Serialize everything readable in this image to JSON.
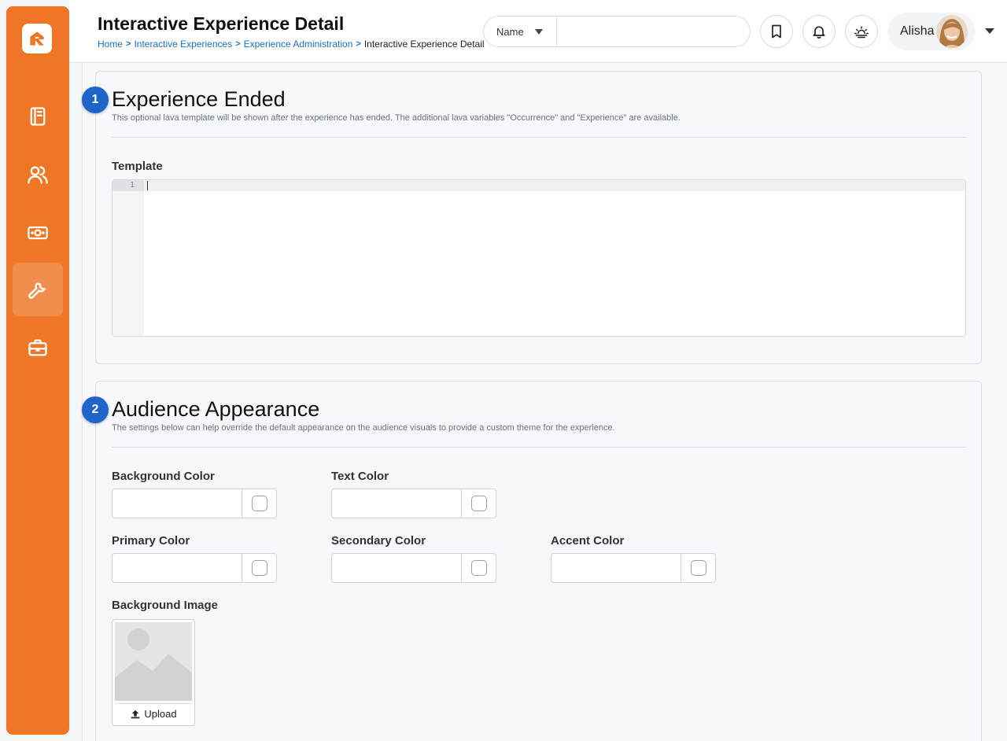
{
  "header": {
    "title": "Interactive Experience Detail",
    "breadcrumb": [
      "Home",
      "Interactive Experiences",
      "Experience Administration"
    ],
    "breadcrumb_current": "Interactive Experience Detail",
    "search": {
      "type_label": "Name",
      "value": "",
      "placeholder": ""
    },
    "user": {
      "name": "Alisha"
    }
  },
  "sidebar": {
    "items": [
      {
        "icon": "book-icon"
      },
      {
        "icon": "people-icon"
      },
      {
        "icon": "money-icon"
      },
      {
        "icon": "wrench-icon",
        "active": true
      },
      {
        "icon": "briefcase-icon"
      }
    ]
  },
  "sections": {
    "ended": {
      "badge": "1",
      "title": "Experience Ended",
      "description": "This optional lava template will be shown after the experience has ended. The additional lava variables \"Occurrence\" and \"Experience\" are available.",
      "template_label": "Template",
      "line_number": "1",
      "template_value": ""
    },
    "appearance": {
      "badge": "2",
      "title": "Audience Appearance",
      "description": "The settings below can help override the default appearance on the audience visuals to provide a custom theme for the experience.",
      "background_color_label": "Background Color",
      "text_color_label": "Text Color",
      "primary_color_label": "Primary Color",
      "secondary_color_label": "Secondary Color",
      "accent_color_label": "Accent Color",
      "background_image_label": "Background Image",
      "upload_label": "Upload"
    }
  },
  "colors": {
    "brand": "#ee7625",
    "link": "#1a6fc4",
    "badge": "#1f64c8"
  }
}
